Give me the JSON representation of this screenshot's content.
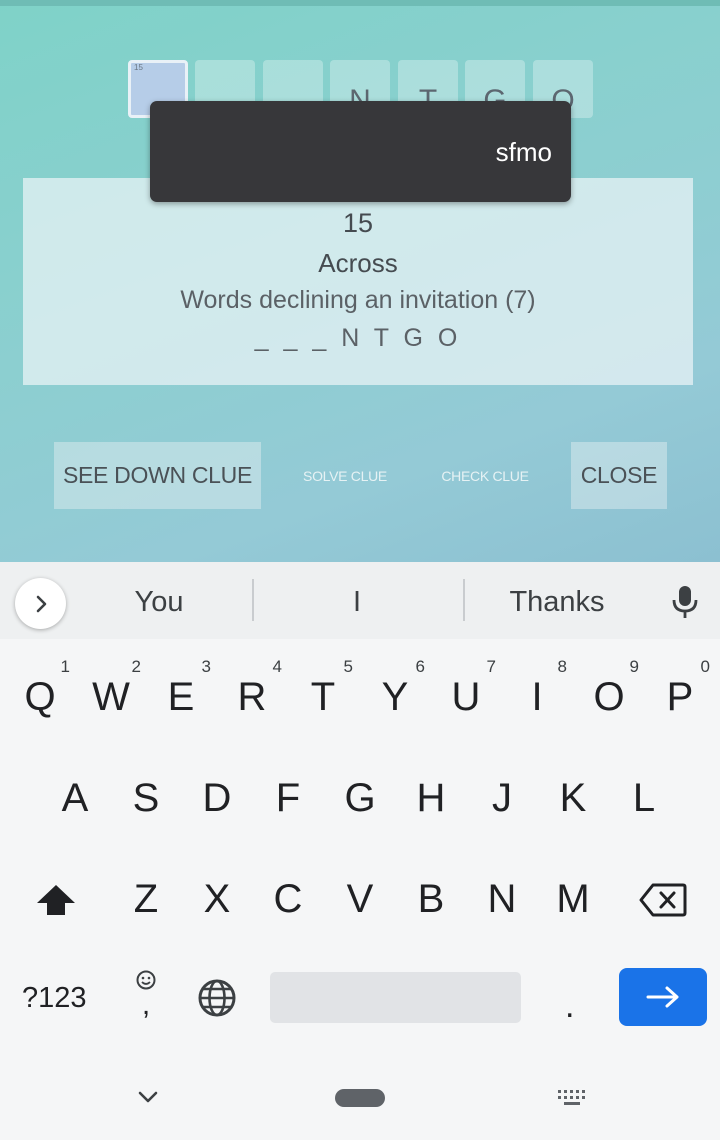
{
  "puzzle": {
    "tiles": [
      {
        "number": "15",
        "letter": "",
        "selected": true
      },
      {
        "number": "",
        "letter": "",
        "selected": false
      },
      {
        "number": "",
        "letter": "",
        "selected": false
      },
      {
        "number": "",
        "letter": "N",
        "selected": false
      },
      {
        "number": "",
        "letter": "T",
        "selected": false
      },
      {
        "number": "",
        "letter": "G",
        "selected": false
      },
      {
        "number": "",
        "letter": "O",
        "selected": false
      }
    ]
  },
  "tooltip": {
    "text": "sfmo"
  },
  "clue": {
    "number": "15",
    "direction": "Across",
    "text": "Words declining an invitation (7)",
    "pattern": "_ _ _ N T G O"
  },
  "actions": {
    "see_down": "SEE DOWN CLUE",
    "solve": "SOLVE CLUE",
    "check": "CHECK CLUE",
    "close": "CLOSE"
  },
  "suggestions": {
    "left": "You",
    "middle": "I",
    "right": "Thanks"
  },
  "keyboard": {
    "row1": [
      [
        "Q",
        "1"
      ],
      [
        "W",
        "2"
      ],
      [
        "E",
        "3"
      ],
      [
        "R",
        "4"
      ],
      [
        "T",
        "5"
      ],
      [
        "Y",
        "6"
      ],
      [
        "U",
        "7"
      ],
      [
        "I",
        "8"
      ],
      [
        "O",
        "9"
      ],
      [
        "P",
        "0"
      ]
    ],
    "row2": [
      "A",
      "S",
      "D",
      "F",
      "G",
      "H",
      "J",
      "K",
      "L"
    ],
    "row3": [
      "Z",
      "X",
      "C",
      "V",
      "B",
      "N",
      "M"
    ],
    "symbols": "?123",
    "comma": ",",
    "period": "."
  },
  "colors": {
    "enter": "#1a73e8",
    "tile_selected": "#b6cde8",
    "tooltip": "#37373a"
  }
}
